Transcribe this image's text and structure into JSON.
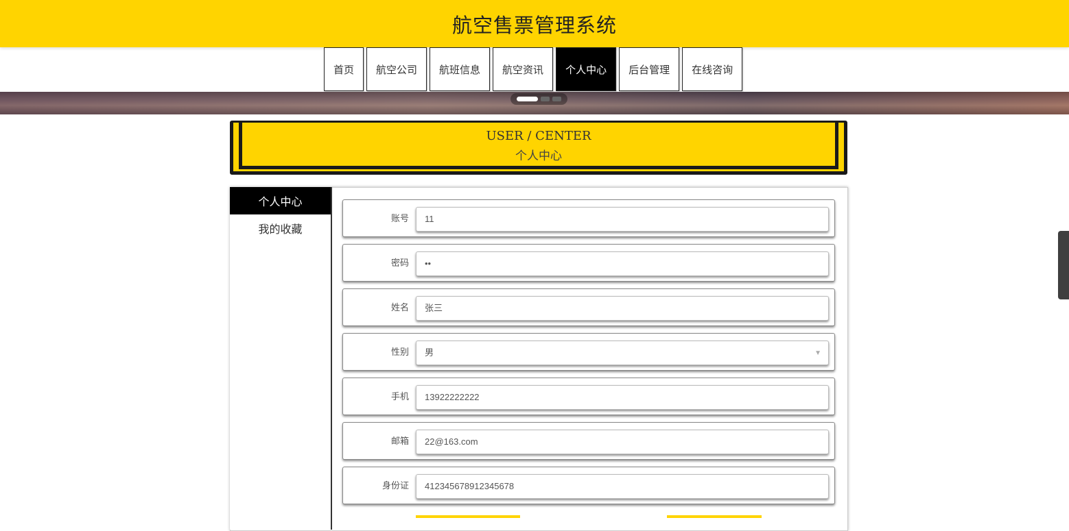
{
  "site": {
    "title": "航空售票管理系统"
  },
  "nav": {
    "items": [
      {
        "label": "首页"
      },
      {
        "label": "航空公司"
      },
      {
        "label": "航班信息"
      },
      {
        "label": "航空资讯"
      },
      {
        "label": "个人中心",
        "active": true
      },
      {
        "label": "后台管理"
      },
      {
        "label": "在线咨询"
      }
    ]
  },
  "banner": {
    "active_slide": 1,
    "slide_count": 3
  },
  "section": {
    "title_en": "USER / CENTER",
    "title_cn": "个人中心"
  },
  "sidebar": {
    "items": [
      {
        "label": "个人中心",
        "active": true
      },
      {
        "label": "我的收藏"
      }
    ]
  },
  "form": {
    "fields": [
      {
        "label": "账号",
        "value": "11",
        "type": "text"
      },
      {
        "label": "密码",
        "value": "••",
        "type": "password"
      },
      {
        "label": "姓名",
        "value": "张三",
        "type": "text"
      },
      {
        "label": "性别",
        "value": "男",
        "type": "select",
        "arrow": "▼"
      },
      {
        "label": "手机",
        "value": "13922222222",
        "type": "text"
      },
      {
        "label": "邮箱",
        "value": "22@163.com",
        "type": "text"
      },
      {
        "label": "身份证",
        "value": "412345678912345678",
        "type": "text"
      }
    ]
  },
  "colors": {
    "brand_yellow": "#ffd400",
    "dark": "#000000"
  }
}
